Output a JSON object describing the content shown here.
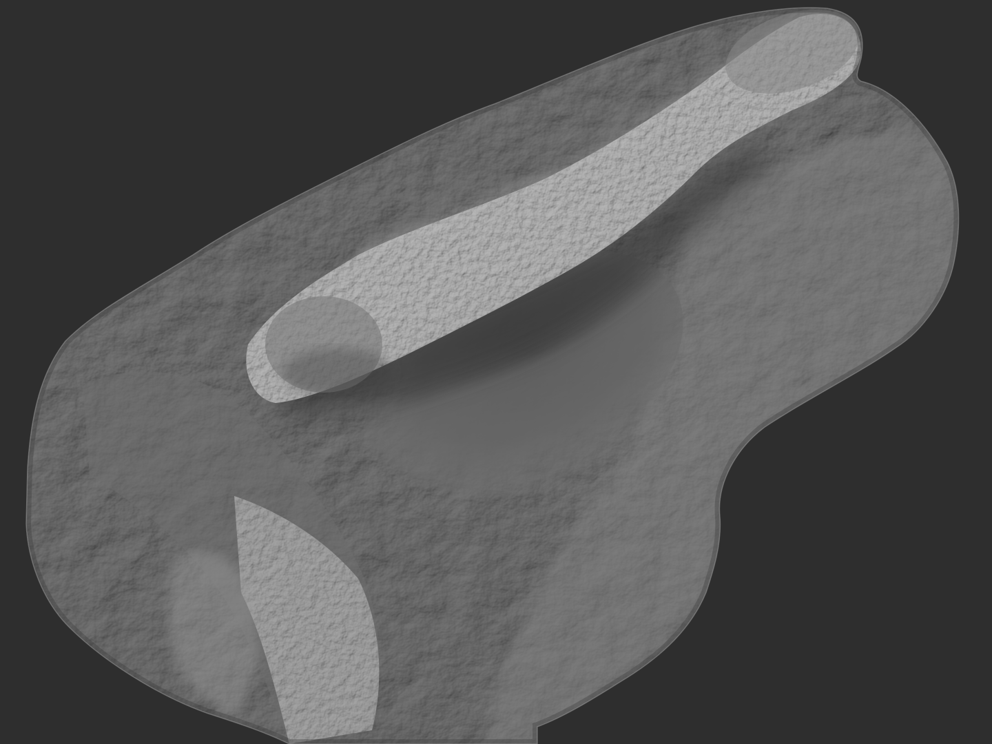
{
  "viewport": {
    "background": "#2e2e2e",
    "subject": "sculpted-rock-terrain-mesh",
    "material": "matte-gray-clay",
    "surface_color": "#7a7a7a",
    "highlight_color": "#bdbdbd",
    "shadow_color": "#3a3a3a"
  }
}
